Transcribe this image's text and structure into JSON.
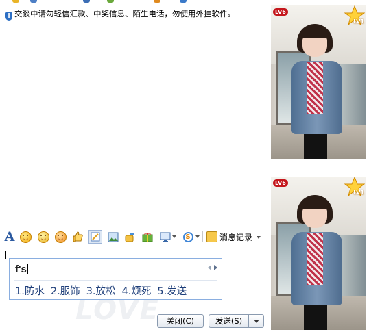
{
  "chat": {
    "notice_text": "交谈中请勿轻信汇款、中奖信息、陌生电话，勿使用外挂软件。"
  },
  "toolbar": {
    "icons": [
      "font-icon",
      "smiley-icon",
      "animated-face-icon",
      "wink-face-icon",
      "thumbs-up-icon",
      "screenshot-icon",
      "picture-icon",
      "music-icon",
      "gift-icon",
      "screen-share-icon",
      "soso-icon"
    ],
    "history_label": "消息记录"
  },
  "ime": {
    "composition": "f's",
    "candidates": [
      "1.防水",
      "2.服饰",
      "3.放松",
      "4.烦死",
      "5.发送"
    ]
  },
  "buttons": {
    "close_label": "关闭(C)",
    "send_label": "发送(S)"
  },
  "profiles": [
    {
      "vip": "LV6",
      "level": "LV1"
    },
    {
      "vip": "LV6",
      "level": "LV1"
    }
  ],
  "colors": {
    "accent_blue": "#2c5aa0",
    "ime_border": "#8aaee0",
    "vip_red": "#c4161c"
  }
}
